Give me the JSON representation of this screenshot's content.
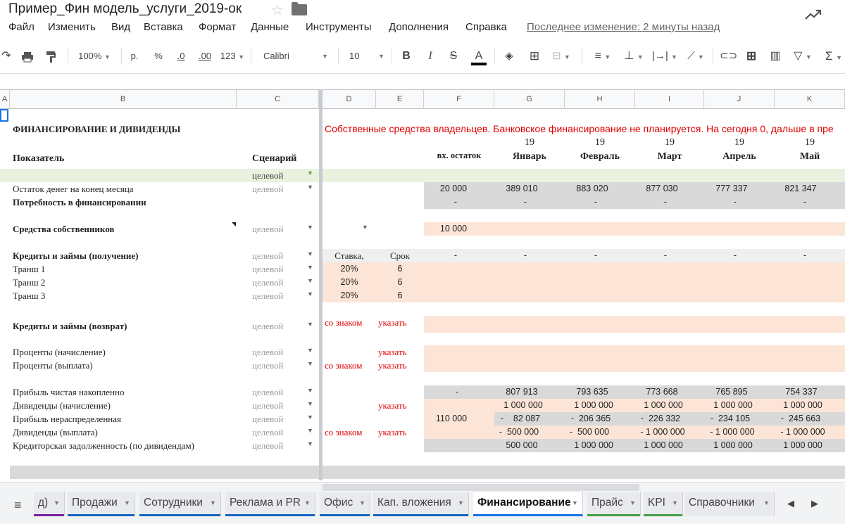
{
  "doc": {
    "title": "Пример_Фин модель_услуги_2019-ок"
  },
  "menu": {
    "items": [
      "Файл",
      "Изменить",
      "Вид",
      "Вставка",
      "Формат",
      "Данные",
      "Инструменты",
      "Дополнения",
      "Справка"
    ],
    "last_edit": "Последнее изменение: 2 минуты назад"
  },
  "toolbar": {
    "zoom": "100%",
    "currency": "р.",
    "percent": "%",
    "dec_less": ".0",
    "dec_more": ".00",
    "more_formats": "123",
    "font": "Calibri",
    "font_size": "10",
    "bold": "B",
    "italic": "I",
    "strike": "S",
    "text_color": "A"
  },
  "columns": [
    "A",
    "B",
    "C",
    "D",
    "E",
    "F",
    "G",
    "H",
    "I",
    "J",
    "K"
  ],
  "sheet": {
    "section_title": "ФИНАНСИРОВАНИЕ И ДИВИДЕНДЫ",
    "note": "Собственные средства владельцев. Банковское финансирование не планируется. На сегодня 0, дальше в пре",
    "hdr_indicator": "Показатель",
    "hdr_scenario": "Сценарий",
    "hdr_open_balance": "вх. остаток",
    "years": [
      "19",
      "19",
      "19",
      "19",
      "19"
    ],
    "months": [
      "Январь",
      "Февраль",
      "Март",
      "Апрель",
      "Май"
    ],
    "scenario_top": "целевой",
    "rows": {
      "cash_end": {
        "label": "Остаток денег на конец месяца",
        "scenario": "целевой",
        "open": "20 000",
        "vals": [
          "389 010",
          "883 020",
          "877 030",
          "777 337",
          "821 347"
        ]
      },
      "fin_need": {
        "label": "Потребность в финансировании",
        "open": "-",
        "vals": [
          "-",
          "-",
          "-",
          "-",
          "-"
        ]
      },
      "owners": {
        "label": "Средства собственников",
        "scenario": "целевой",
        "open": "10 000"
      },
      "loans_get": {
        "label": "Кредиты и займы (получение)",
        "scenario": "целевой",
        "rate_hdr": "Ставка,",
        "term_hdr": "Срок",
        "open": "-",
        "vals": [
          "-",
          "-",
          "-",
          "-",
          "-"
        ]
      },
      "tranches": [
        {
          "label": "Транш 1",
          "scenario": "целевой",
          "rate": "20%",
          "term": "6"
        },
        {
          "label": "Транш 2",
          "scenario": "целевой",
          "rate": "20%",
          "term": "6"
        },
        {
          "label": "Транш 3",
          "scenario": "целевой",
          "rate": "20%",
          "term": "6"
        }
      ],
      "loans_ret": {
        "label": "Кредиты и займы (возврат)",
        "scenario": "целевой",
        "sign": "со знаком",
        "specify": "указать"
      },
      "interest_acc": {
        "label": "Проценты (начисление)",
        "scenario": "целевой",
        "specify": "указать"
      },
      "interest_pay": {
        "label": "Проценты (выплата)",
        "scenario": "целевой",
        "sign": "со знаком",
        "specify": "указать"
      },
      "profit_cum": {
        "label": "Прибыль чистая накопленно",
        "scenario": "целевой",
        "open": "-",
        "vals": [
          "807 913",
          "793 635",
          "773 668",
          "765 895",
          "754 337"
        ]
      },
      "div_acc": {
        "label": "Дивиденды (начисление)",
        "scenario": "целевой",
        "specify": "указать",
        "vals": [
          "1 000 000",
          "1 000 000",
          "1 000 000",
          "1 000 000",
          "1 000 000"
        ]
      },
      "retained": {
        "label": "Прибыль нераспределенная",
        "scenario": "целевой",
        "open": "110 000",
        "vals": [
          "-    82 087",
          "-  206 365",
          "-  226 332",
          "-  234 105",
          "-  245 663"
        ]
      },
      "div_pay": {
        "label": "Дивиденды (выплата)",
        "scenario": "целевой",
        "sign": "со знаком",
        "specify": "указать",
        "vals": [
          "-  500 000",
          "-  500 000",
          "- 1 000 000",
          "- 1 000 000",
          "- 1 000 000"
        ]
      },
      "payable": {
        "label": "Кредиторская задолженность (по дивидендам)",
        "scenario": "целевой",
        "vals": [
          "500 000",
          "1 000 000",
          "1 000 000",
          "1 000 000",
          "1 000 000"
        ]
      }
    }
  },
  "tabs": [
    "д)",
    "Продажи",
    "Сотрудники",
    "Реклама и PR",
    "Офис",
    "Кап. вложения",
    "Финансирование",
    "Прайс",
    "KPI",
    "Справочники"
  ],
  "colors": {
    "accent": "#1a73e8",
    "note_red": "#e00000",
    "input_fill": "#fce5d7",
    "calc_fill": "#d9d9d9"
  }
}
